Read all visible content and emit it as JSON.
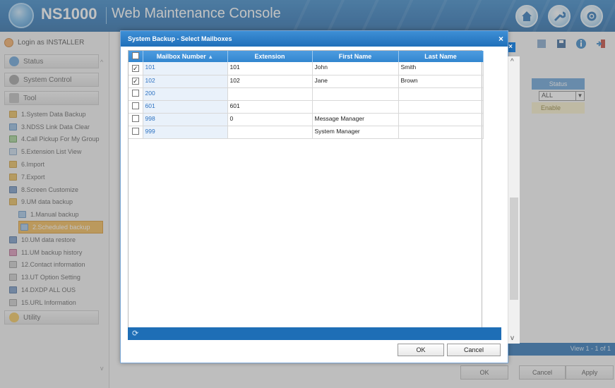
{
  "header": {
    "product": "NS1000",
    "console_title": "Web Maintenance Console"
  },
  "sidebar": {
    "login": "Login as INSTALLER",
    "status_label": "Status",
    "system_control_label": "System Control",
    "tool_label": "Tool",
    "utility_label": "Utility",
    "items": [
      {
        "label": "1.System Data Backup"
      },
      {
        "label": "3.NDSS Link Data Clear"
      },
      {
        "label": "4.Call Pickup For My Group"
      },
      {
        "label": "5.Extension List View"
      },
      {
        "label": "6.Import"
      },
      {
        "label": "7.Export"
      },
      {
        "label": "8.Screen Customize"
      },
      {
        "label": "9.UM data backup"
      },
      {
        "label": "1.Manual backup"
      },
      {
        "label": "2.Scheduled backup"
      },
      {
        "label": "10.UM data restore"
      },
      {
        "label": "11.UM backup history"
      },
      {
        "label": "12.Contact information"
      },
      {
        "label": "13.UT Option Setting"
      },
      {
        "label": "14.DXDP ALL OUS"
      },
      {
        "label": "15.URL Information"
      }
    ]
  },
  "main": {
    "status_header": "Status",
    "status_filter": "ALL",
    "status_value": "Enable",
    "view_count": "View 1 - 1 of 1",
    "ok_label": "OK",
    "cancel_label": "Cancel",
    "apply_label": "Apply"
  },
  "dialog": {
    "title": "System Backup - Select Mailboxes",
    "columns": [
      "Mailbox Number",
      "Extension",
      "First Name",
      "Last Name"
    ],
    "rows": [
      {
        "checked": true,
        "mailbox": "101",
        "extension": "101",
        "first": "John",
        "last": "Smith"
      },
      {
        "checked": true,
        "mailbox": "102",
        "extension": "102",
        "first": "Jane",
        "last": "Brown"
      },
      {
        "checked": false,
        "mailbox": "200",
        "extension": "",
        "first": "",
        "last": ""
      },
      {
        "checked": false,
        "mailbox": "601",
        "extension": "601",
        "first": "",
        "last": ""
      },
      {
        "checked": false,
        "mailbox": "998",
        "extension": "0",
        "first": "Message Manager",
        "last": ""
      },
      {
        "checked": false,
        "mailbox": "999",
        "extension": "",
        "first": "System Manager",
        "last": ""
      }
    ],
    "ok_label": "OK",
    "cancel_label": "Cancel"
  }
}
